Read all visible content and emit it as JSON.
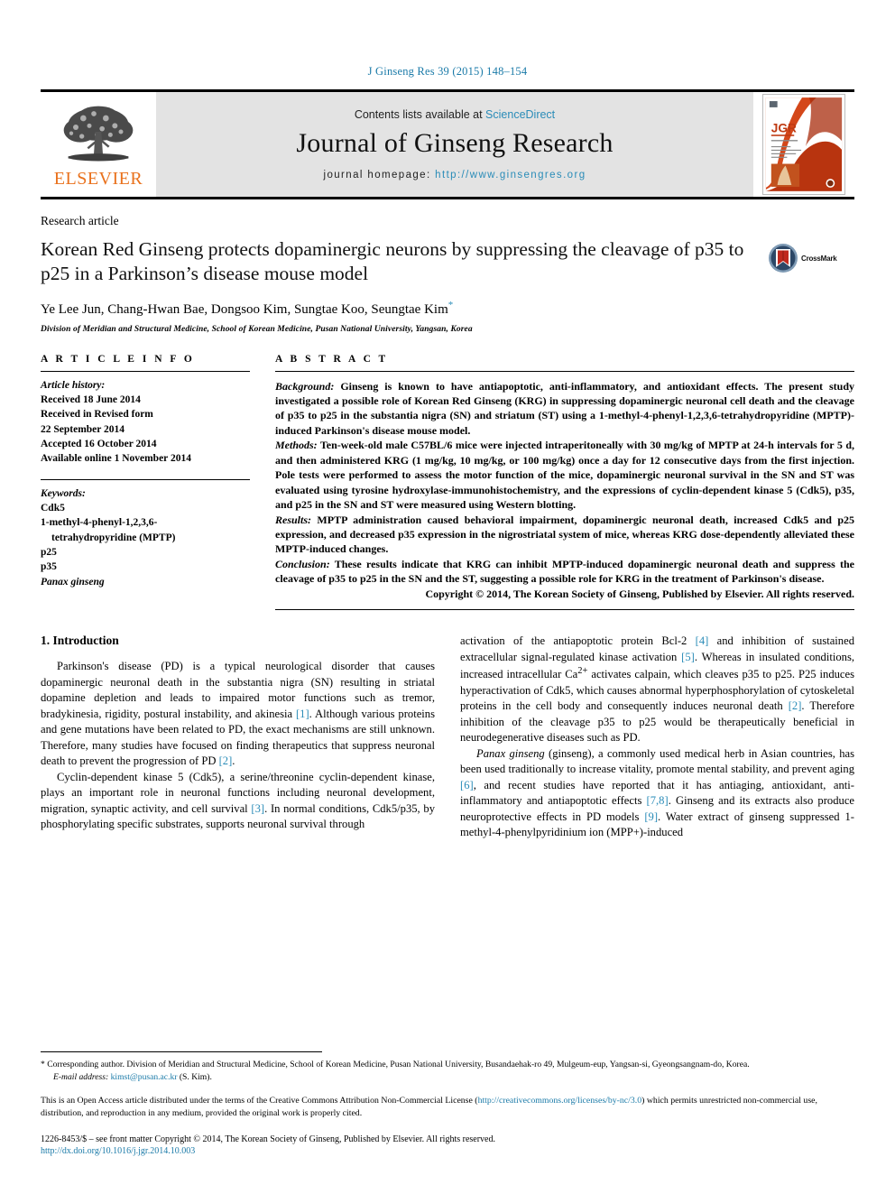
{
  "running_head": "J Ginseng Res 39 (2015) 148–154",
  "masthead": {
    "contents_prefix": "Contents lists available at ",
    "sciencedirect": "ScienceDirect",
    "journal_title": "Journal of Ginseng Research",
    "homepage_prefix": "journal homepage: ",
    "homepage_url": "http://www.ginsengres.org",
    "publisher_name": "ELSEVIER",
    "cover_alt": "JGR journal cover",
    "accent_link": "#2a8cb8",
    "publisher_orange": "#E9711C"
  },
  "article": {
    "type": "Research article",
    "title": "Korean Red Ginseng protects dopaminergic neurons by suppressing the cleavage of p35 to p25 in a Parkinson’s disease mouse model",
    "authors": "Ye Lee Jun, Chang-Hwan Bae, Dongsoo Kim, Sungtae Koo, Seungtae Kim",
    "author_star": "*",
    "affiliation": "Division of Meridian and Structural Medicine, School of Korean Medicine, Pusan National University, Yangsan, Korea",
    "crossmark_label": "CrossMark"
  },
  "article_info": {
    "heading": "A R T I C L E  I N F O",
    "history_label": "Article history:",
    "history": [
      "Received 18 June 2014",
      "Received in Revised form",
      "22 September 2014",
      "Accepted 16 October 2014",
      "Available online 1 November 2014"
    ],
    "keywords_label": "Keywords:",
    "keywords": [
      "Cdk5",
      "1-methyl-4-phenyl-1,2,3,6-",
      "tetrahydropyridine (MPTP)",
      "p25",
      "p35",
      "Panax ginseng"
    ]
  },
  "abstract": {
    "heading": "A B S T R A C T",
    "background_label": "Background:",
    "background_text": " Ginseng is known to have antiapoptotic, anti-inflammatory, and antioxidant effects. The present study investigated a possible role of Korean Red Ginseng (KRG) in suppressing dopaminergic neuronal cell death and the cleavage of p35 to p25 in the substantia nigra (SN) and striatum (ST) using a 1-methyl-4-phenyl-1,2,3,6-tetrahydropyridine (MPTP)-induced Parkinson's disease mouse model.",
    "methods_label": "Methods:",
    "methods_text": " Ten-week-old male C57BL/6 mice were injected intraperitoneally with 30 mg/kg of MPTP at 24-h intervals for 5 d, and then administered KRG (1 mg/kg, 10 mg/kg, or 100 mg/kg) once a day for 12 consecutive days from the first injection. Pole tests were performed to assess the motor function of the mice, dopaminergic neuronal survival in the SN and ST was evaluated using tyrosine hydroxylase-immunohistochemistry, and the expressions of cyclin-dependent kinase 5 (Cdk5), p35, and p25 in the SN and ST were measured using Western blotting.",
    "results_label": "Results:",
    "results_text": " MPTP administration caused behavioral impairment, dopaminergic neuronal death, increased Cdk5 and p25 expression, and decreased p35 expression in the nigrostriatal system of mice, whereas KRG dose-dependently alleviated these MPTP-induced changes.",
    "conclusion_label": "Conclusion:",
    "conclusion_text": " These results indicate that KRG can inhibit MPTP-induced dopaminergic neuronal death and suppress the cleavage of p35 to p25 in the SN and the ST, suggesting a possible role for KRG in the treatment of Parkinson's disease.",
    "copyright": "Copyright © 2014, The Korean Society of Ginseng, Published by Elsevier. All rights reserved."
  },
  "introduction": {
    "heading": "1. Introduction",
    "left": {
      "p1_a": "Parkinson's disease (PD) is a typical neurological disorder that causes dopaminergic neuronal death in the substantia nigra (SN) resulting in striatal dopamine depletion and leads to impaired motor functions such as tremor, bradykinesia, rigidity, postural instability, and akinesia ",
      "p1_ref1": "[1]",
      "p1_b": ". Although various proteins and gene mutations have been related to PD, the exact mechanisms are still unknown. Therefore, many studies have focused on finding therapeutics that suppress neuronal death to prevent the progression of PD ",
      "p1_ref2": "[2]",
      "p1_c": ".",
      "p2_a": "Cyclin-dependent kinase 5 (Cdk5), a serine/threonine cyclin-dependent kinase, plays an important role in neuronal functions including neuronal development, migration, synaptic activity, and cell survival ",
      "p2_ref1": "[3]",
      "p2_b": ". In normal conditions, Cdk5/p35, by phosphorylating specific substrates, supports neuronal survival through"
    },
    "right": {
      "p1_a": "activation of the antiapoptotic protein Bcl-2 ",
      "p1_ref1": "[4]",
      "p1_b": " and inhibition of sustained extracellular signal-regulated kinase activation ",
      "p1_ref2": "[5]",
      "p1_c": ". Whereas in insulated conditions, increased intracellular Ca",
      "p1_sup": "2+",
      "p1_d": " activates calpain, which cleaves p35 to p25. P25 induces hyperactivation of Cdk5, which causes abnormal hyperphosphorylation of cytoskeletal proteins in the cell body and consequently induces neuronal death ",
      "p1_ref3": "[2]",
      "p1_e": ". Therefore inhibition of the cleavage p35 to p25 would be therapeutically beneficial in neurodegenerative diseases such as PD.",
      "p2_ital": "Panax ginseng",
      "p2_a": " (ginseng), a commonly used medical herb in Asian countries, has been used traditionally to increase vitality, promote mental stability, and prevent aging ",
      "p2_ref1": "[6]",
      "p2_b": ", and recent studies have reported that it has antiaging, antioxidant, anti-inflammatory and antiapoptotic effects ",
      "p2_ref2": "[7,8]",
      "p2_c": ". Ginseng and its extracts also produce neuroprotective effects in PD models ",
      "p2_ref3": "[9]",
      "p2_d": ". Water extract of ginseng suppressed 1-methyl-4-phenylpyridinium ion (MPP+)-induced"
    }
  },
  "footer": {
    "corresponding": "* Corresponding author. Division of Meridian and Structural Medicine, School of Korean Medicine, Pusan National University, Busandaehak-ro 49, Mulgeum-eup, Yangsan-si, Gyeongsangnam-do, Korea.",
    "email_label": "E-mail address:",
    "email": "kimst@pusan.ac.kr",
    "email_suffix": " (S. Kim).",
    "license_a": "This is an Open Access article distributed under the terms of the Creative Commons Attribution Non-Commercial License (",
    "license_url": "http://creativecommons.org/licenses/by-nc/3.0",
    "license_b": ") which permits unrestricted non-commercial use, distribution, and reproduction in any medium, provided the original work is properly cited.",
    "issn_line": "1226-8453/$ – see front matter Copyright © 2014, The Korean Society of Ginseng, Published by Elsevier. All rights reserved.",
    "doi": "http://dx.doi.org/10.1016/j.jgr.2014.10.003"
  }
}
